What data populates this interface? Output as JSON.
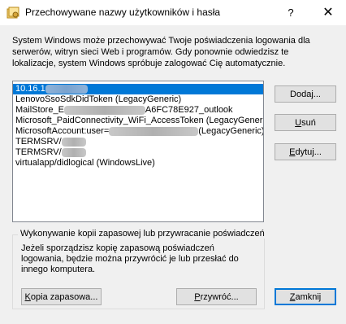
{
  "window": {
    "title": "Przechowywane nazwy użytkowników i hasła",
    "help_glyph": "?",
    "close_glyph": "✕"
  },
  "intro": {
    "text": "System Windows może przechowywać Twoje poświadczenia logowania dla serwerów, witryn sieci Web i programów. Gdy ponownie odwiedzisz te lokalizacje, system Windows spróbuje zalogować Cię automatycznie."
  },
  "credentials": [
    {
      "prefix": "10.16.1",
      "suffix": ""
    },
    {
      "prefix": "LenovoSsoSdkDidToken (LegacyGeneric)",
      "suffix": ""
    },
    {
      "prefix": "MailStore_E",
      "suffix": "A6FC78E927_outlook"
    },
    {
      "prefix": "Microsoft_PaidConnectivity_WiFi_AccessToken (LegacyGeneric)",
      "suffix": ""
    },
    {
      "prefix": "MicrosoftAccount:user=",
      "suffix": "(LegacyGeneric)"
    },
    {
      "prefix": "TERMSRV/",
      "suffix": ""
    },
    {
      "prefix": "TERMSRV/",
      "suffix": ""
    },
    {
      "prefix": "virtualapp/didlogical (WindowsLive)",
      "suffix": ""
    }
  ],
  "buttons": {
    "add": {
      "pre": "Doda",
      "key": "j",
      "post": "..."
    },
    "remove": {
      "pre": "",
      "key": "U",
      "post": "suń"
    },
    "edit": {
      "pre": "",
      "key": "E",
      "post": "dytuj..."
    },
    "backup": {
      "pre": "",
      "key": "K",
      "post": "opia zapasowa..."
    },
    "restore": {
      "pre": "",
      "key": "P",
      "post": "rzywróć..."
    },
    "close": {
      "pre": "",
      "key": "Z",
      "post": "amknij"
    }
  },
  "backup_group": {
    "legend": "Wykonywanie kopii zapasowej lub przywracanie poświadczeń",
    "text": "Jeżeli sporządzisz kopię zapasową poświadczeń logowania, będzie można przywrócić je lub przesłać do innego komputera."
  }
}
